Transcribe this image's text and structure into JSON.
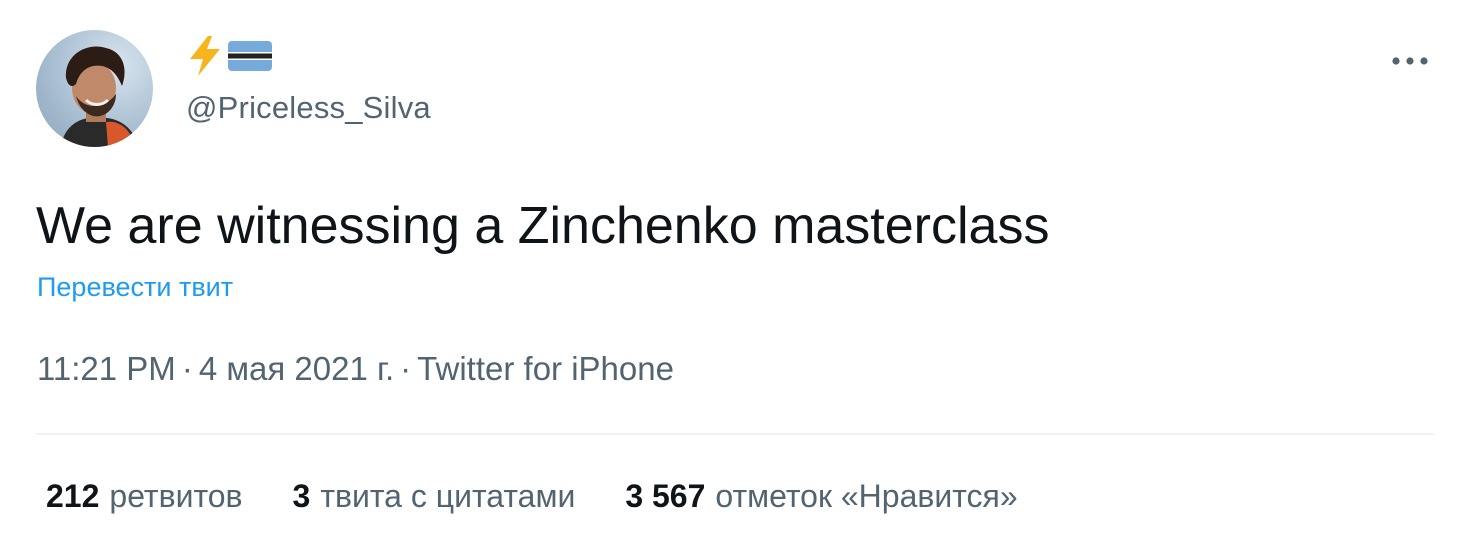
{
  "author": {
    "display_name_icons": [
      "lightning-bolt-emoji",
      "botswana-flag-emoji"
    ],
    "handle": "@Priceless_Silva"
  },
  "tweet": {
    "text": "We are witnessing a Zinchenko masterclass",
    "translate_label": "Перевести твит",
    "time": "11:21 PM",
    "date": "4 мая 2021 г.",
    "separator": "·",
    "source": "Twitter for iPhone"
  },
  "stats": {
    "retweets": {
      "count": "212",
      "label": "ретвитов"
    },
    "quotes": {
      "count": "3",
      "label": "твита с цитатами"
    },
    "likes": {
      "count": "3 567",
      "label": "отметок «Нравится»"
    }
  },
  "colors": {
    "text_primary": "#0f1419",
    "text_secondary": "#536471",
    "link": "#1d9bf0",
    "divider": "#eff3f4"
  }
}
